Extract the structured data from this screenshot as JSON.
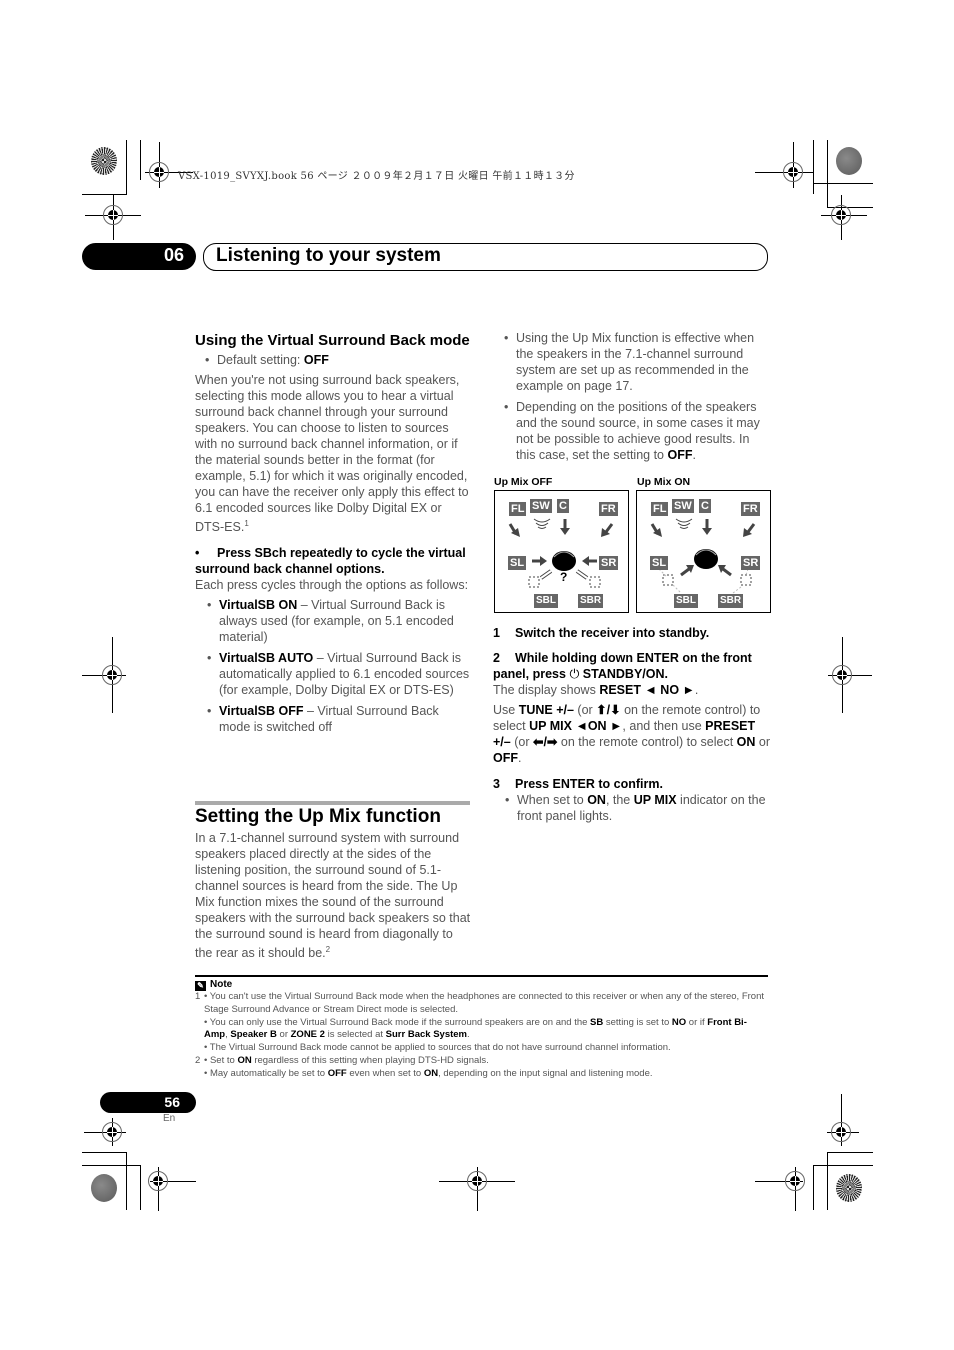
{
  "print_header": "VSX-1019_SVYXJ.book  56 ページ  ２００９年２月１７日  火曜日  午前１１時１３分",
  "chapter": {
    "number": "06",
    "title": "Listening to your system"
  },
  "left_column": {
    "section1": {
      "heading": "Using the Virtual Surround Back mode",
      "default_label": "Default setting: ",
      "default_value": "OFF",
      "paragraph": "When you're not using surround back speakers, selecting this mode allows you to hear a virtual surround back channel through your surround speakers. You can choose to listen to sources with no surround back channel information, or if the material sounds better in the format (for example, 5.1) for which it was originally encoded, you can have the receiver only apply this effect to 6.1 encoded sources like Dolby Digital EX or DTS-ES.",
      "paragraph_footnote": "1",
      "instruction": "Press SBch repeatedly to cycle the virtual surround back channel options.",
      "instruction_followup": "Each press cycles through the options as follows:",
      "options": [
        {
          "name": "VirtualSB ON",
          "desc": " – Virtual Surround Back is always used (for example, on 5.1 encoded material)"
        },
        {
          "name": "VirtualSB AUTO",
          "desc": " – Virtual Surround Back is automatically applied to 6.1 encoded sources (for example, Dolby Digital EX or DTS-ES)"
        },
        {
          "name": "VirtualSB OFF",
          "desc": " – Virtual Surround Back mode is switched off"
        }
      ]
    },
    "section2": {
      "heading": "Setting the Up Mix function",
      "paragraph": "In a 7.1-channel surround system with surround speakers placed directly at the sides of the listening position, the surround sound of 5.1-channel sources is heard from the side. The Up Mix function mixes the sound of the surround speakers with the surround back speakers so that the surround sound is heard from diagonally to the rear as it should be.",
      "paragraph_footnote": "2"
    }
  },
  "right_column": {
    "bullets": [
      {
        "text": "Using the Up Mix function is effective when the speakers in the 7.1-channel surround system are set up as recommended in the example on page 17."
      },
      {
        "text": "Depending on the positions of the speakers and the sound source, in some cases it may not be possible to achieve good results. In this case, set the setting to ",
        "bold": "OFF",
        "tail": "."
      }
    ],
    "diagrams": [
      {
        "label": "Up Mix OFF",
        "question": "?"
      },
      {
        "label": "Up Mix ON"
      }
    ],
    "speakers": [
      "FL",
      "SW",
      "C",
      "FR",
      "SL",
      "SR",
      "SBL",
      "SBR"
    ],
    "steps": {
      "s1_num": "1",
      "s1": "Switch the receiver into standby.",
      "s2_num": "2",
      "s2a": "While holding down ENTER on the front panel, press ",
      "s2_icon": "⏻",
      "s2b": " STANDBY/ON.",
      "display_pre": "The display shows ",
      "display_val": "RESET ◄ NO ►",
      "display_post": ".",
      "use1": "Use ",
      "tune": "TUNE +/–",
      "use2": " (or ",
      "updown": "⬆/⬇",
      "use3": " on the remote control) to select ",
      "upmix": "UP MIX  ◄ON ►",
      "use4": ", and then use ",
      "preset": "PRESET +/–",
      "use5": " (or ",
      "leftright": "⬅/➡",
      "use6": " on the remote control) to select ",
      "on": "ON",
      "use7": " or ",
      "off": "OFF",
      "use8": ".",
      "s3_num": "3",
      "s3": "Press ENTER to confirm.",
      "s3_b1": "When set to ",
      "s3_on": "ON",
      "s3_b2": ", the ",
      "s3_upmix": "UP MIX",
      "s3_b3": " indicator on the front panel lights."
    }
  },
  "note": {
    "title": "Note",
    "lines": [
      {
        "prefix": "1",
        "parts": [
          [
            "n",
            "• You can't use the Virtual Surround Back mode when the headphones are connected to this receiver or when any of the stereo, Front Stage Surround Advance or Stream Direct mode is selected."
          ]
        ]
      },
      {
        "prefix": "",
        "parts": [
          [
            "n",
            "• You can only use the Virtual Surround Back mode if the surround speakers are on and the "
          ],
          [
            "b",
            "SB"
          ],
          [
            "n",
            " setting is set to "
          ],
          [
            "b",
            "NO"
          ],
          [
            "n",
            " or if "
          ],
          [
            "b",
            "Front Bi-Amp"
          ],
          [
            "n",
            ", "
          ],
          [
            "b",
            "Speaker B"
          ],
          [
            "n",
            " or "
          ],
          [
            "b",
            "ZONE 2"
          ],
          [
            "n",
            " is selected at "
          ],
          [
            "b",
            "Surr Back System"
          ],
          [
            "n",
            "."
          ]
        ]
      },
      {
        "prefix": "",
        "parts": [
          [
            "n",
            "• The Virtual Surround Back mode cannot be applied to sources that do not have surround channel information."
          ]
        ]
      },
      {
        "prefix": "2",
        "parts": [
          [
            "n",
            "• Set to "
          ],
          [
            "b",
            "ON"
          ],
          [
            "n",
            " regardless of this setting when playing DTS-HD signals."
          ]
        ]
      },
      {
        "prefix": "",
        "parts": [
          [
            "n",
            "• May automatically be set to "
          ],
          [
            "b",
            "OFF"
          ],
          [
            "n",
            " even when set to "
          ],
          [
            "b",
            "ON"
          ],
          [
            "n",
            ", depending on the input signal and listening mode."
          ]
        ]
      }
    ]
  },
  "footer": {
    "page_number": "56",
    "language": "En"
  }
}
